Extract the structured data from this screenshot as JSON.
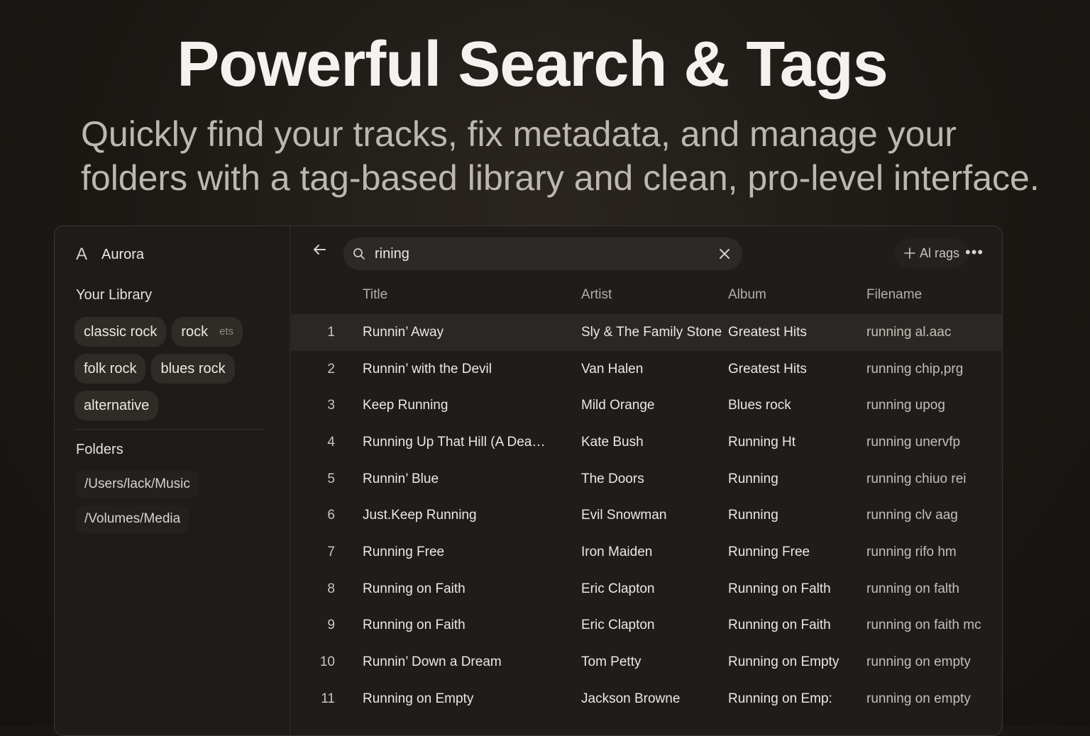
{
  "hero": {
    "title": "Powerful Search & Tags",
    "subtitle_line1": "Quickly find your tracks, fix metadata, and manage your",
    "subtitle_line2": "folders with a tag-based library and clean, pro-level interface."
  },
  "sidebar": {
    "logo": "A",
    "app_name": "Aurora",
    "library_heading": "Your Library",
    "tags": [
      "classic rock",
      "rock",
      "folk rock",
      "blues rock",
      "alternative"
    ],
    "tag_extra": "ets",
    "folders_heading": "Folders",
    "folders": [
      "/Users/lack/Music",
      "/Volumes/Media"
    ]
  },
  "toolbar": {
    "search_value": "rining",
    "tags_button_label": "Al rags",
    "more_label": "•••"
  },
  "table": {
    "columns": {
      "title": "Title",
      "artist": "Artist",
      "album": "Album",
      "filename": "Filename"
    },
    "selected_row": 0,
    "rows": [
      {
        "num": "1",
        "title": "Runnin’ Away",
        "artist": "Sly & The Family Stone",
        "album": "Greatest Hits",
        "filename": "running al.aac"
      },
      {
        "num": "2",
        "title": "Runnin’ with the Devil",
        "artist": "Van Halen",
        "album": "Greatest Hits",
        "filename": "running chip,prg"
      },
      {
        "num": "3",
        "title": "Keep Running",
        "artist": "Mild Orange",
        "album": "Blues rock",
        "filename": "running upog"
      },
      {
        "num": "4",
        "title": "Running Up That Hill (A Dea…",
        "artist": "Kate Bush",
        "album": "Running Ht",
        "filename": "running unervfp"
      },
      {
        "num": "5",
        "title": "Runnin’ Blue",
        "artist": "The Doors",
        "album": "Running",
        "filename": "running chiuo rei"
      },
      {
        "num": "6",
        "title": "Just.Keep Running",
        "artist": "Evil Snowman",
        "album": "Running",
        "filename": "running clv aag"
      },
      {
        "num": "7",
        "title": "Running Free",
        "artist": "Iron Maiden",
        "album": "Running Free",
        "filename": "running rifo hm"
      },
      {
        "num": "8",
        "title": "Running on Faith",
        "artist": "Eric Clapton",
        "album": "Running on Falth",
        "filename": "running on falth"
      },
      {
        "num": "9",
        "title": "Running on Faith",
        "artist": "Eric Clapton",
        "album": "Running on Faith",
        "filename": "running on faith mc"
      },
      {
        "num": "10",
        "title": "Runnin’ Down a Dream",
        "artist": "Tom Petty",
        "album": "Running on Empty",
        "filename": "running on empty"
      },
      {
        "num": "11",
        "title": "Running on Empty",
        "artist": "Jackson Browne",
        "album": "Running on Emp:",
        "filename": "running on empty"
      }
    ]
  }
}
